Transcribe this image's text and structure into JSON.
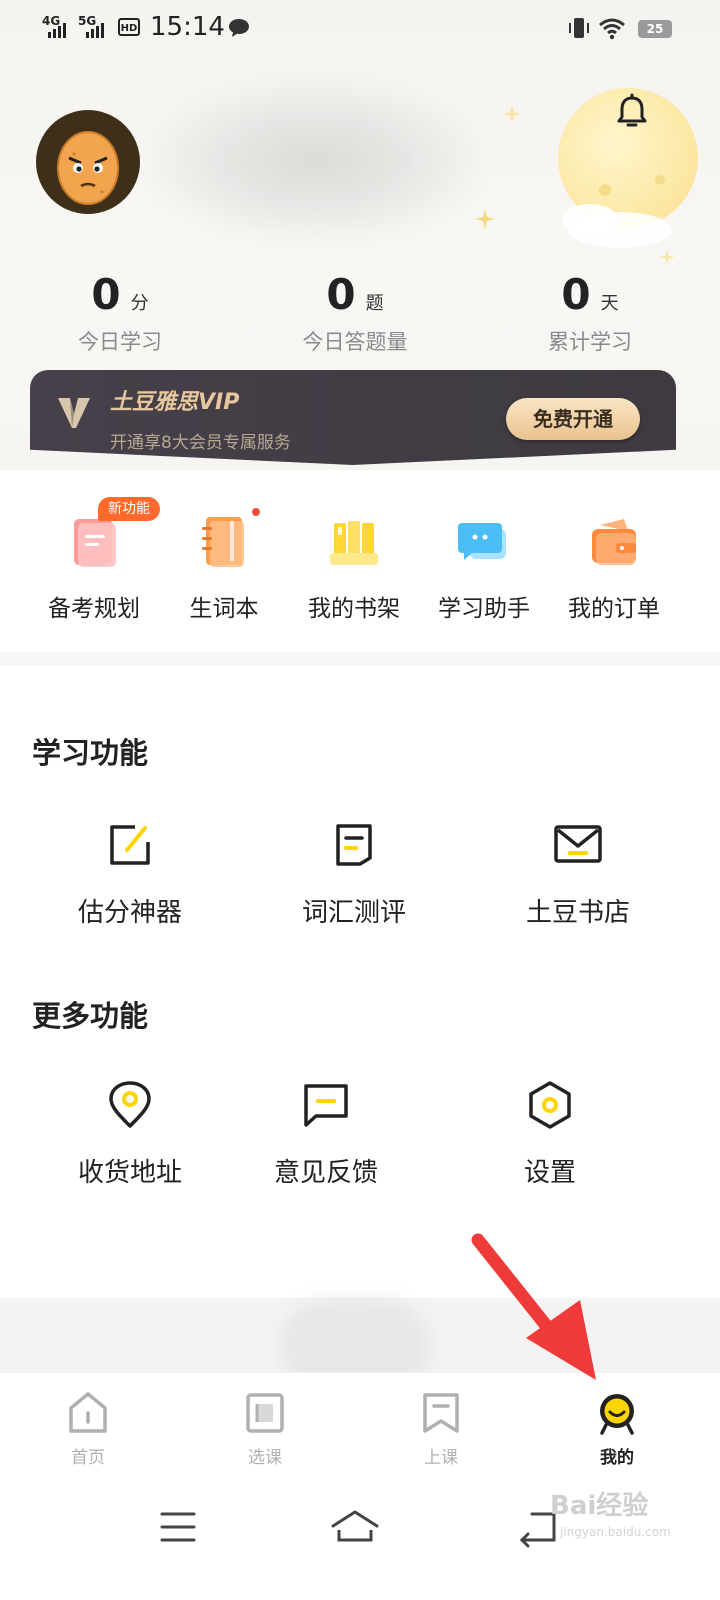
{
  "status_bar": {
    "net1": "4G",
    "net2": "5G",
    "hd": "HD",
    "time": "15:14",
    "battery": "25"
  },
  "stats": [
    {
      "value": "0",
      "unit": "分",
      "label": "今日学习"
    },
    {
      "value": "0",
      "unit": "题",
      "label": "今日答题量"
    },
    {
      "value": "0",
      "unit": "天",
      "label": "累计学习"
    }
  ],
  "vip": {
    "title": "土豆雅思VIP",
    "subtitle": "开通享8大会员专属服务",
    "button": "免费开通"
  },
  "quick_tools": {
    "new_badge": "新功能",
    "items": [
      {
        "label": "备考规划",
        "icon": "plan-icon"
      },
      {
        "label": "生词本",
        "icon": "notebook-icon"
      },
      {
        "label": "我的书架",
        "icon": "bookshelf-icon"
      },
      {
        "label": "学习助手",
        "icon": "assistant-chat-icon"
      },
      {
        "label": "我的订单",
        "icon": "wallet-icon"
      }
    ]
  },
  "learning": {
    "title": "学习功能",
    "items": [
      {
        "label": "估分神器",
        "icon": "edit-pen-icon"
      },
      {
        "label": "词汇测评",
        "icon": "document-icon"
      },
      {
        "label": "土豆书店",
        "icon": "mail-icon"
      }
    ]
  },
  "more": {
    "title": "更多功能",
    "items": [
      {
        "label": "收货地址",
        "icon": "location-pin-icon"
      },
      {
        "label": "意见反馈",
        "icon": "feedback-icon"
      },
      {
        "label": "设置",
        "icon": "settings-hexagon-icon"
      }
    ]
  },
  "tabs": [
    {
      "label": "首页",
      "icon": "home-icon",
      "active": false
    },
    {
      "label": "选课",
      "icon": "course-icon",
      "active": false
    },
    {
      "label": "上课",
      "icon": "bookmark-icon",
      "active": false
    },
    {
      "label": "我的",
      "icon": "profile-face-icon",
      "active": true
    }
  ],
  "colors": {
    "accent_yellow": "#FFD400",
    "vip_gold": "#E8C79C",
    "badge_orange": "#FF6A2C",
    "annotation_red": "#F03A3A"
  },
  "watermark": {
    "text": "Bai经验",
    "sub": "jingyan.baidu.com"
  }
}
